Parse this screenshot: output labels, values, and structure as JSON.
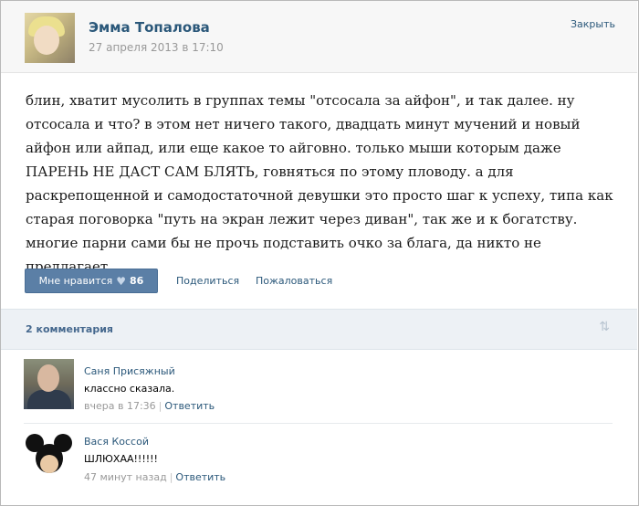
{
  "post": {
    "author": "Эмма Топалова",
    "date": "27 апреля 2013 в 17:10",
    "close_label": "Закрыть",
    "text": "блин, хватит мусолить в группах темы \"отсосала за айфон\", и так далее. ну отсосала и что? в этом нет ничего такого, двадцать минут мучений и новый айфон или айпад, или еще какое то айговно. только мыши которым даже ПАРЕНЬ НЕ ДАСТ САМ БЛЯТЬ, говняться по этому пловоду. а для раскрепощенной и самодостаточной девушки это просто шаг к успеху, типа как старая поговорка \"путь на экран лежит через диван\", так же и к богатству. многие парни сами бы не прочь подставить очко за блага, да никто не предлагает.",
    "like_label": "Мне нравится",
    "like_count": "86",
    "share_label": "Поделиться",
    "complain_label": "Пожаловаться"
  },
  "comments_header": {
    "count_label": "2 комментария"
  },
  "comments": [
    {
      "name": "Саня Присяжный",
      "text": "классно сказала.",
      "time": "вчера в 17:36",
      "separator": "|",
      "reply_label": "Ответить"
    },
    {
      "name": "Вася Коссой",
      "text": "ШЛЮХАА!!!!!!",
      "time": "47 минут назад",
      "separator": "|",
      "reply_label": "Ответить"
    }
  ],
  "icons": {
    "heart": "heart-icon",
    "sort": "sort-arrows-icon"
  },
  "colors": {
    "link": "#2b587a",
    "like_button": "#5b7fa6",
    "comments_bar": "#edf1f5",
    "meta_gray": "#999999"
  }
}
